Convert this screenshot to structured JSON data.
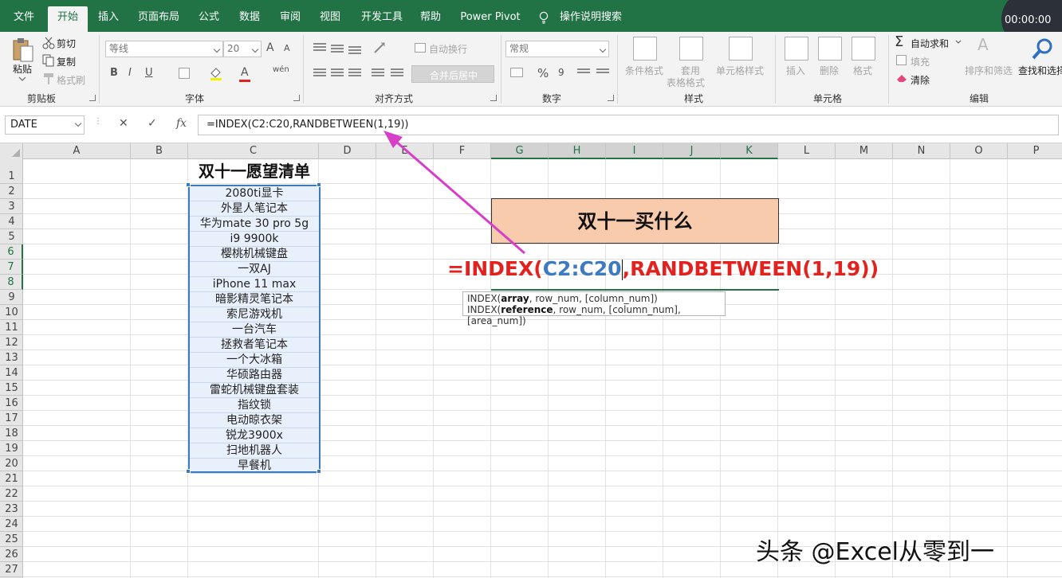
{
  "menu": {
    "tabs": [
      {
        "label": "文件",
        "active": false
      },
      {
        "label": "开始",
        "active": true
      },
      {
        "label": "插入",
        "active": false
      },
      {
        "label": "页面布局",
        "active": false
      },
      {
        "label": "公式",
        "active": false
      },
      {
        "label": "数据",
        "active": false
      },
      {
        "label": "审阅",
        "active": false
      },
      {
        "label": "视图",
        "active": false
      },
      {
        "label": "开发工具",
        "active": false
      },
      {
        "label": "帮助",
        "active": false
      },
      {
        "label": "Power Pivot",
        "active": false
      }
    ],
    "search_label": "操作说明搜索",
    "timer": "00:00:00"
  },
  "ribbon": {
    "clipboard": {
      "paste": "粘贴",
      "cut": "剪切",
      "copy": "复制",
      "format_painter": "格式刷",
      "label": "剪贴板"
    },
    "font": {
      "name": "等线",
      "size": "20",
      "bold": "B",
      "italic": "I",
      "underline": "U",
      "label": "字体",
      "grow": "A",
      "shrink": "A",
      "phonetic": "wén"
    },
    "alignment": {
      "wrap": "自动换行",
      "merge": "合并后居中",
      "label": "对齐方式"
    },
    "number": {
      "format": "常规",
      "percent": "%",
      "comma": "9",
      "label": "数字"
    },
    "styles": {
      "conditional": "条件格式",
      "table_line1": "套用",
      "table_line2": "表格格式",
      "cell_styles": "单元格样式",
      "label": "样式"
    },
    "cells": {
      "insert": "插入",
      "delete": "删除",
      "format": "格式",
      "label": "单元格"
    },
    "editing": {
      "autosum": "自动求和",
      "fill": "填充",
      "clear": "清除",
      "sort": "排序和筛选",
      "find": "查找和选择",
      "label": "编辑"
    }
  },
  "formula_bar": {
    "name_box": "DATE",
    "cancel": "✕",
    "enter": "✓",
    "fx": "fx",
    "formula": "=INDEX(C2:C20,RANDBETWEEN(1,19))"
  },
  "grid": {
    "columns": [
      {
        "label": "A",
        "w": 135,
        "sel": false
      },
      {
        "label": "B",
        "w": 72,
        "sel": false
      },
      {
        "label": "C",
        "w": 164,
        "sel": false
      },
      {
        "label": "D",
        "w": 72,
        "sel": false
      },
      {
        "label": "E",
        "w": 72,
        "sel": false
      },
      {
        "label": "F",
        "w": 72,
        "sel": false
      },
      {
        "label": "G",
        "w": 72,
        "sel": true
      },
      {
        "label": "H",
        "w": 72,
        "sel": true
      },
      {
        "label": "I",
        "w": 72,
        "sel": true
      },
      {
        "label": "J",
        "w": 72,
        "sel": true
      },
      {
        "label": "K",
        "w": 72,
        "sel": true
      },
      {
        "label": "L",
        "w": 72,
        "sel": false
      },
      {
        "label": "M",
        "w": 72,
        "sel": false
      },
      {
        "label": "N",
        "w": 72,
        "sel": false
      },
      {
        "label": "O",
        "w": 72,
        "sel": false
      },
      {
        "label": "P",
        "w": 72,
        "sel": false
      }
    ],
    "selected_rows": [
      6,
      7,
      8
    ]
  },
  "sheet": {
    "list_title": "双十一愿望清单",
    "items": [
      "2080ti显卡",
      "外星人笔记本",
      "华为mate 30 pro 5g",
      "i9 9900k",
      "樱桃机械键盘",
      "一双AJ",
      "iPhone 11 max",
      "暗影精灵笔记本",
      "索尼游戏机",
      "一台汽车",
      "拯救者笔记本",
      "一个大冰箱",
      "华硕路由器",
      "雷蛇机械键盘套装",
      "指纹锁",
      "电动晾衣架",
      "锐龙3900x",
      "扫地机器人",
      "早餐机"
    ],
    "merged_title": "双十一买什么",
    "edit_formula": {
      "eq_index": "=INDEX(",
      "ref": "C2:C20",
      "rest": ",RANDBETWEEN(1,19))"
    },
    "tooltip": {
      "l1_fn": "INDEX(",
      "l1_bold": "array",
      "l1_rest": ", row_num, [column_num])",
      "l2_fn": "INDEX(",
      "l2_bold": "reference",
      "l2_rest": ", row_num, [column_num], [area_num])"
    }
  },
  "watermark": "头条 @Excel从零到一",
  "colors": {
    "excel_green": "#217346",
    "arrow": "#d63fc7",
    "merged_fill": "#f8cbad",
    "range_blue": "#3e7ac0",
    "formula_red": "#e2221e"
  }
}
